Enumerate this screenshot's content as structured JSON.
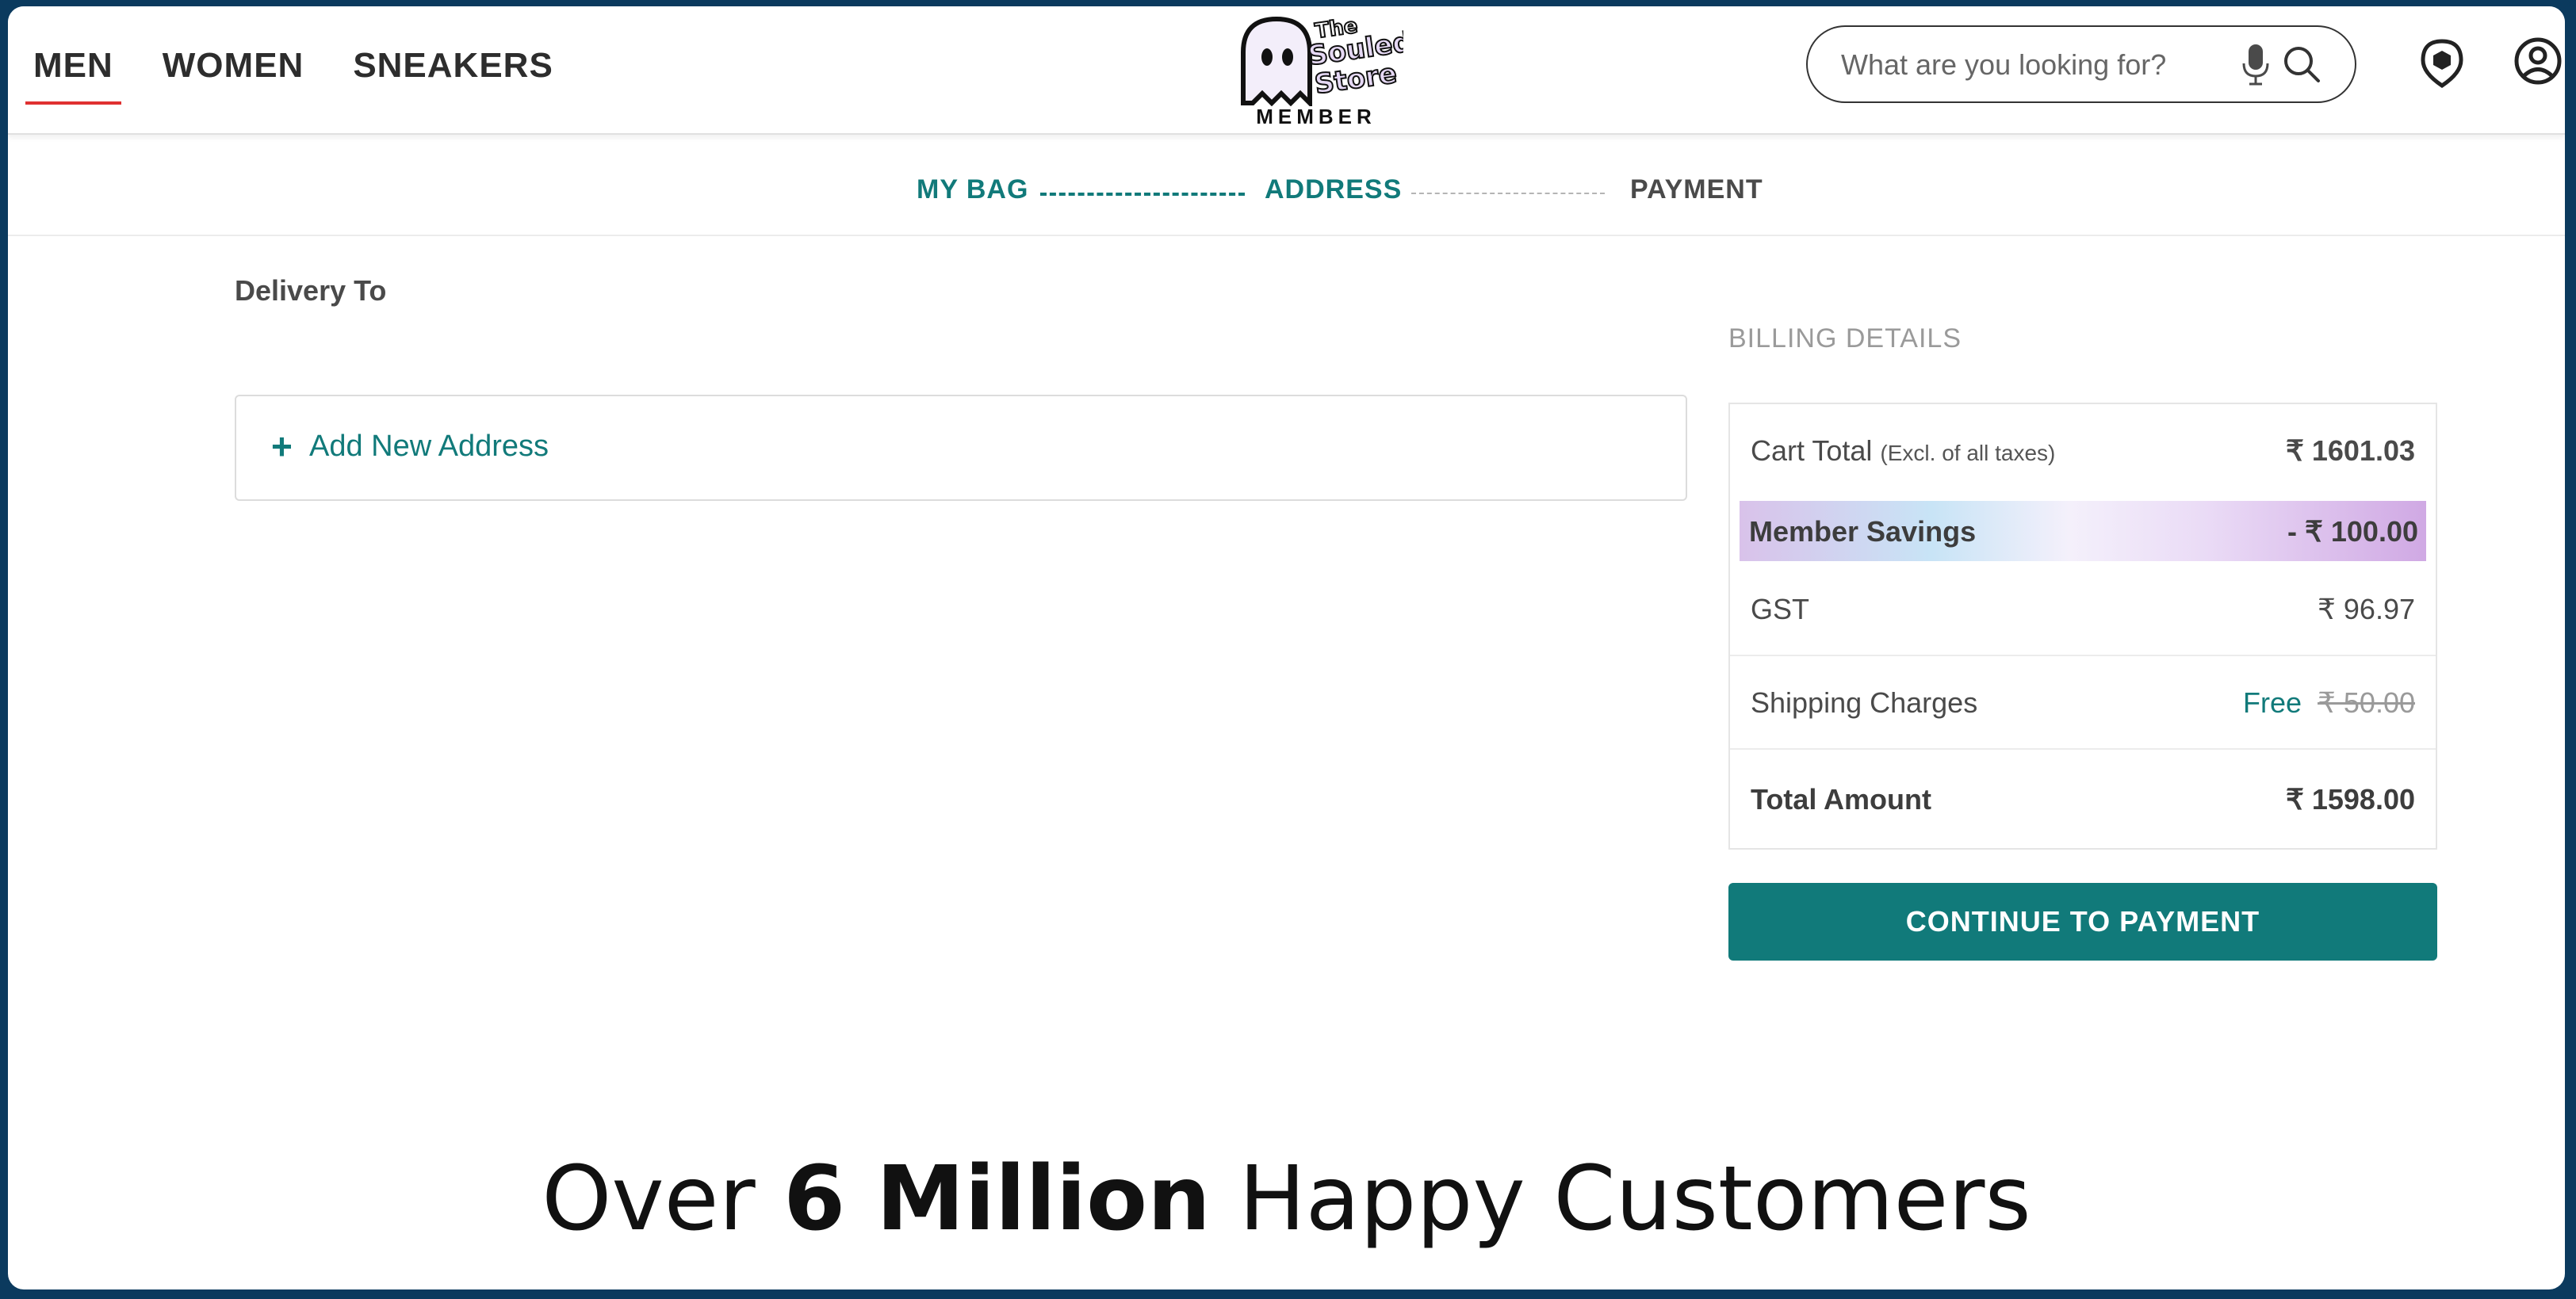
{
  "nav": {
    "items": [
      {
        "label": "MEN",
        "active": true
      },
      {
        "label": "WOMEN",
        "active": false
      },
      {
        "label": "SNEAKERS",
        "active": false
      }
    ]
  },
  "logo": {
    "line1": "The",
    "line2": "Souled",
    "line3": "Store",
    "tagline": "MEMBER"
  },
  "search": {
    "placeholder": "What are you looking for?",
    "icons": [
      "microphone-icon",
      "search-icon"
    ]
  },
  "header_icons": [
    "member-badge-icon",
    "user-account-icon"
  ],
  "stepper": {
    "steps": [
      {
        "label": "MY BAG",
        "state": "done"
      },
      {
        "label": "ADDRESS",
        "state": "current"
      },
      {
        "label": "PAYMENT",
        "state": "pending"
      }
    ]
  },
  "delivery": {
    "title": "Delivery To",
    "add_plus": "+",
    "add_label": "Add New Address"
  },
  "billing": {
    "title": "BILLING DETAILS",
    "cart_total_label": "Cart Total",
    "cart_total_note": "(Excl. of all taxes)",
    "cart_total_value": "₹ 1601.03",
    "savings_label": "Member Savings",
    "savings_value": "- ₹ 100.00",
    "gst_label": "GST",
    "gst_value": "₹ 96.97",
    "shipping_label": "Shipping Charges",
    "shipping_free": "Free",
    "shipping_original": "₹ 50.00",
    "total_label": "Total Amount",
    "total_value": "₹ 1598.00"
  },
  "cta": {
    "label": "CONTINUE TO PAYMENT"
  },
  "tagline": {
    "prefix": "Over",
    "highlight": "6 Million",
    "suffix": "Happy Customers"
  },
  "colors": {
    "accent": "#117a7a",
    "nav_active_underline": "#e03131",
    "frame": "#0b3a5e"
  }
}
